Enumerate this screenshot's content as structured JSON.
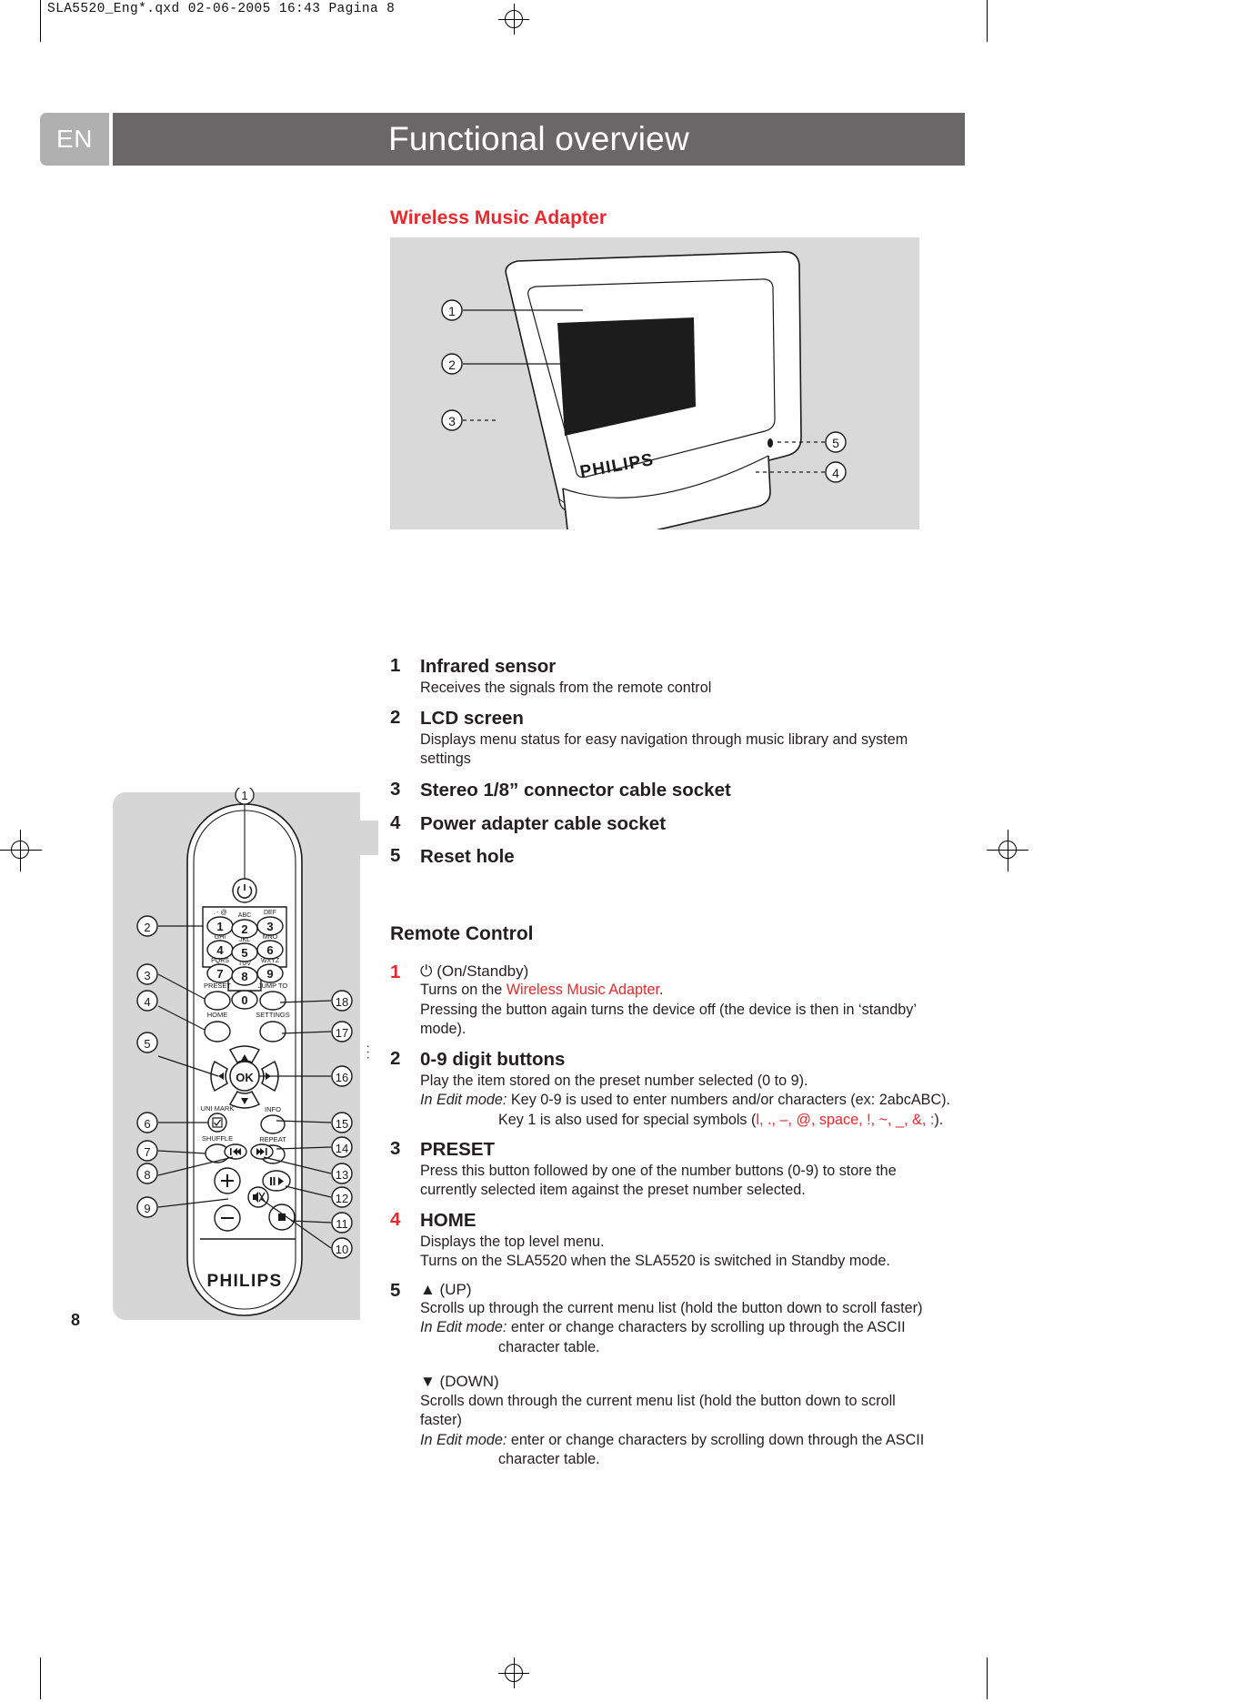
{
  "slug": "SLA5520_Eng*.qxd  02-06-2005  16:43  Pagina 8",
  "header": {
    "lang_tab": "EN",
    "title": "Functional overview"
  },
  "page_number": "8",
  "colors": {
    "red": "#e8282d",
    "header_bar": "#6a6768",
    "lang_tab": "#b0b0b0",
    "photo_bg": "#d9d9d9",
    "remote_panel": "#d6d6d6"
  },
  "adapter_section": {
    "title": "Wireless Music Adapter",
    "photo": {
      "brand": "PHILIPS",
      "callouts": [
        "1",
        "2",
        "3",
        "4",
        "5"
      ]
    },
    "items": [
      {
        "num": "1",
        "num_red": false,
        "title": "Infrared sensor",
        "lines": [
          "Receives the signals from the remote control"
        ]
      },
      {
        "num": "2",
        "num_red": false,
        "title": "LCD screen",
        "lines": [
          "Displays menu status for easy navigation through music library and system settings"
        ]
      },
      {
        "num": "3",
        "num_red": false,
        "title": "Stereo 1/8” connector cable socket",
        "lines": []
      },
      {
        "num": "4",
        "num_red": false,
        "title": "Power adapter cable socket",
        "lines": []
      },
      {
        "num": "5",
        "num_red": false,
        "title": "Reset hole",
        "lines": []
      }
    ]
  },
  "remote_section": {
    "heading": "Remote Control",
    "items": [
      {
        "num": "1",
        "num_red": true,
        "title_icon": "power-standby-icon",
        "title": "(On/Standby)",
        "line1_pre": "Turns on the ",
        "line1_red": "Wireless Music Adapter",
        "line1_post": ".",
        "line2": "Pressing the button again turns the device off (the device is then in ‘standby’ mode)."
      },
      {
        "num": "2",
        "num_red": false,
        "title": "0-9 digit buttons",
        "line1": "Play the item stored on the preset number selected (0 to 9).",
        "line2_italic": "In Edit mode:",
        "line2": " Key 0-9 is used to enter numbers and/or characters (ex: 2abcABC).",
        "line3_pre": "Key 1 is also used for special symbols (",
        "line3_red": "l, ., –, @, space, !, ~, _, &, :",
        "line3_post": ")."
      },
      {
        "num": "3",
        "num_red": false,
        "title": "PRESET",
        "line1": "Press this button followed by one of the number buttons (0-9) to store the currently selected item against the preset number selected."
      },
      {
        "num": "4",
        "num_red": true,
        "title": "HOME",
        "line1": "Displays the top level menu.",
        "line2": "Turns on the SLA5520 when the SLA5520 is switched in Standby mode."
      },
      {
        "num": "5",
        "num_red": false,
        "title_up": "▲ (UP)",
        "up_line1": "Scrolls up through the current menu list (hold the button down to scroll faster)",
        "up_italic": "In Edit mode:",
        "up_line2": " enter or change characters by scrolling up through the ASCII",
        "up_line3": "character table.",
        "title_down": "▼ (DOWN)",
        "down_line1": "Scrolls down through the current menu list (hold the button down to scroll faster)",
        "down_italic": "In Edit mode:",
        "down_line2": " enter or change characters by scrolling down through the ASCII",
        "down_line3": "character table."
      }
    ],
    "diagram": {
      "brand": "PHILIPS",
      "callouts_left": [
        "1",
        "2",
        "3",
        "4",
        "5",
        "6",
        "7",
        "8",
        "9"
      ],
      "callouts_right": [
        "18",
        "17",
        "16",
        "15",
        "14",
        "13",
        "12",
        "11",
        "10"
      ],
      "keypad": [
        {
          "digit": "1",
          "letters": ". - @"
        },
        {
          "digit": "2",
          "letters": "ABC"
        },
        {
          "digit": "3",
          "letters": "DEF"
        },
        {
          "digit": "4",
          "letters": "GHI"
        },
        {
          "digit": "5",
          "letters": "JKL"
        },
        {
          "digit": "6",
          "letters": "MNO"
        },
        {
          "digit": "7",
          "letters": "PQRS"
        },
        {
          "digit": "8",
          "letters": "TUV"
        },
        {
          "digit": "9",
          "letters": "WXYZ"
        },
        {
          "digit": "0",
          "letters": ""
        }
      ],
      "button_labels": [
        "PRESET",
        "JUMP TO",
        "HOME",
        "SETTINGS",
        "UNI MARK",
        "INFO",
        "SHUFFLE",
        "REPEAT"
      ],
      "ok_label": "OK"
    }
  }
}
